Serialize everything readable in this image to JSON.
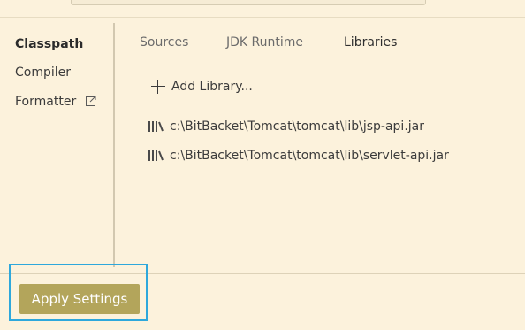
{
  "sidebar": {
    "items": [
      {
        "label": "Classpath",
        "active": true
      },
      {
        "label": "Compiler",
        "active": false
      },
      {
        "label": "Formatter",
        "active": false,
        "icon": "external-link-icon"
      }
    ]
  },
  "tabs": [
    {
      "label": "Sources",
      "active": false
    },
    {
      "label": "JDK Runtime",
      "active": false
    },
    {
      "label": "Libraries",
      "active": true
    }
  ],
  "libraries": {
    "add_label": "Add Library...",
    "items": [
      {
        "icon": "library-icon",
        "path": "c:\\BitBacket\\Tomcat\\tomcat\\lib\\jsp-api.jar"
      },
      {
        "icon": "library-icon",
        "path": "c:\\BitBacket\\Tomcat\\tomcat\\lib\\servlet-api.jar"
      }
    ]
  },
  "footer": {
    "apply_label": "Apply Settings"
  },
  "colors": {
    "background": "#fcf2dc",
    "apply_button": "#b3a55b",
    "highlight": "#2ea8dc"
  }
}
